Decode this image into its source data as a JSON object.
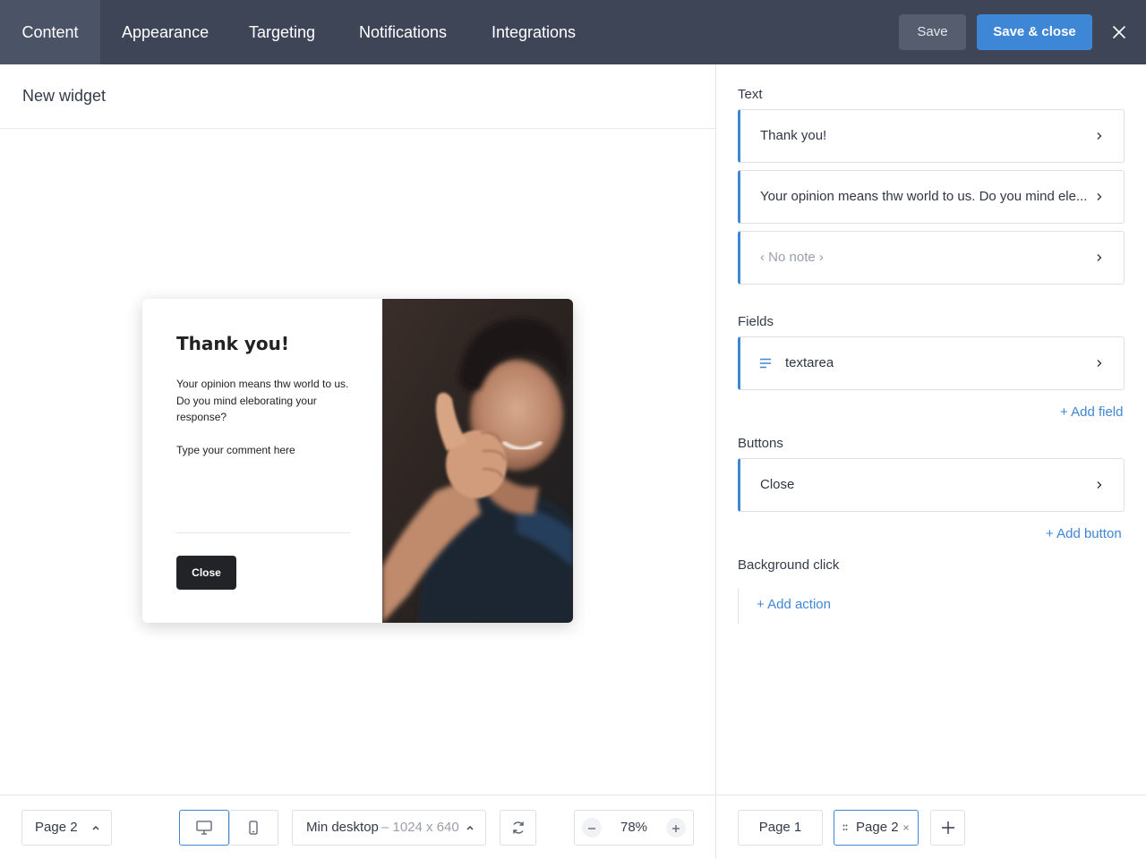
{
  "topbar": {
    "tabs": [
      {
        "label": "Content",
        "active": true
      },
      {
        "label": "Appearance",
        "active": false
      },
      {
        "label": "Targeting",
        "active": false
      },
      {
        "label": "Notifications",
        "active": false
      },
      {
        "label": "Integrations",
        "active": false
      }
    ],
    "save_label": "Save",
    "save_close_label": "Save & close",
    "close_icon": "close-icon",
    "accent": "#3e86d6",
    "background": "#3d4557"
  },
  "editor": {
    "title": "New widget"
  },
  "preview": {
    "heading": "Thank you!",
    "body": "Your opinion means thw world to us. Do you mind eleborating your response?",
    "textarea_placeholder": "Type your comment here",
    "close_button": "Close",
    "image": "photo-man-thumbs-up"
  },
  "panel": {
    "text_section": {
      "label": "Text",
      "items": [
        {
          "text": "Thank you!",
          "muted": false
        },
        {
          "text": "Your opinion means thw world to us. Do you mind ele...",
          "muted": false
        },
        {
          "text": "‹ No note ›",
          "muted": true
        }
      ]
    },
    "fields_section": {
      "label": "Fields",
      "items": [
        {
          "text": "textarea",
          "icon": "text-lines-icon"
        }
      ],
      "add_label": "+ Add field"
    },
    "buttons_section": {
      "label": "Buttons",
      "items": [
        {
          "text": "Close"
        }
      ],
      "add_label": "+ Add button"
    },
    "background_section": {
      "label": "Background click",
      "add_label": "+ Add action"
    }
  },
  "bottom": {
    "page_select": "Page 2",
    "device_icons": [
      "desktop-icon",
      "mobile-icon"
    ],
    "viewport_label": "Min desktop",
    "viewport_size": "– 1024 x 640",
    "refresh_icon": "refresh-icon",
    "zoom": "78%",
    "page_tabs": [
      "Page 1",
      "Page 2"
    ],
    "add_page_icon": "plus-icon"
  }
}
